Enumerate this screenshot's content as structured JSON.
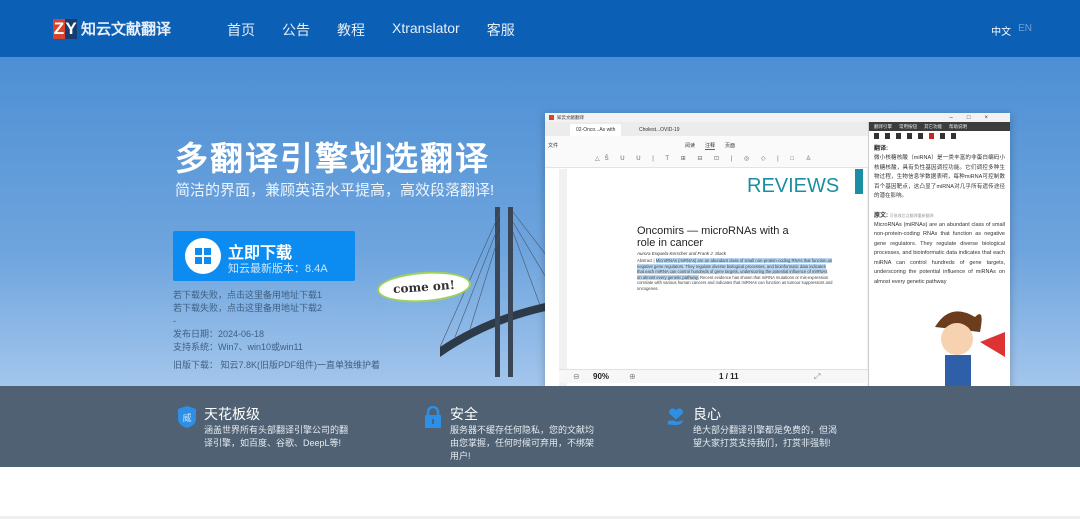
{
  "header": {
    "logo_mark": [
      "Z",
      "Y"
    ],
    "logo_text": "知云文献翻译",
    "nav": [
      "首页",
      "公告",
      "教程",
      "Xtranslator",
      "客服"
    ],
    "active_nav": "首页",
    "lang": {
      "zh": "中文",
      "en": "EN"
    }
  },
  "hero": {
    "title": "多翻译引擎划选翻译",
    "subtitle": "简洁的界面，兼顾英语水平提高，高效段落翻译!",
    "download": {
      "label": "立即下载",
      "version": "知云最新版本：8.4A"
    },
    "alt_links": [
      "若下载失败，点击这里备用地址下载1",
      "若下载失败，点击这里备用地址下载2"
    ],
    "dash": "-",
    "release_date": "发布日期：2024-06-18",
    "systems": "支持系统：Win7、win10或win11",
    "old_version": "旧版下载： 知云7.8K(旧版PDF组件)一直单独维护着"
  },
  "app_preview": {
    "window_title": "知云文献翻译",
    "tabs": [
      "02-Onco...As with",
      "Cholest...OVID-19"
    ],
    "menu": "文件",
    "modes": [
      "阅读",
      "注释",
      "页面"
    ],
    "reviews": "REVIEWS",
    "article_title": "Oncomirs — microRNAs with a role in cancer",
    "authors": "Aurora Esquela-Kerscher and Frank J. Slack",
    "abstract_prefix": "Abstract |",
    "abstract_highlight": "MicroRNAs (miRNAs) are an abundant class of small non-protein-coding RNAs that function as negative gene regulators. They regulate diverse biological processes, and bioinformatic data indicates that each miRNA can control hundreds of gene targets, underscoring the potential influence of miRNAs on almost every genetic pathway.",
    "abstract_rest": "Recent evidence has shown that miRNA mutations or mis-expression correlate with various human cancers and indicates that miRNAs can function as tumour suppressors and oncogenes.",
    "zoom": "90%",
    "page": "1 / 11",
    "panel_menu": [
      "翻译引擎",
      "常用按钮",
      "其它功能",
      "帮助说明"
    ],
    "translation_heading": "翻译:",
    "translation": "微小核糖核酸（miRNA）是一类丰富的非蛋白编码小核糖核酸，具有负性基因调控功能。它们调控多种生物过程，生物信息学数据表明，每种miRNA可控制数百个基因靶点，这凸显了miRNA对几乎所有遗传途径的潜在影响。",
    "source_heading": "原文:",
    "source_hint": "可修改后点翻译重新翻译",
    "source": "MicroRNAs (miRNAs) are an abundant class of small non-protein-coding RNAs that function as negative gene regulators. They regulate diverse biological processes, and bioinformatic data indicates that each miRNA can control hundreds of gene targets, underscoring the potential influence of miRNAs on almost every genetic pathway",
    "sticker": "come on!"
  },
  "features": [
    {
      "icon": "shield-icon",
      "badge": "威",
      "title": "天花板级",
      "desc": "涵盖世界所有头部翻译引擎公司的翻译引擎，如百度、谷歌、DeepL等!"
    },
    {
      "icon": "lock-icon",
      "title": "安全",
      "desc": "服务器不缓存任何隐私，您的文献均由您掌握，任何时候可弃用，不绑架用户!"
    },
    {
      "icon": "heart-hand-icon",
      "title": "良心",
      "desc": "绝大部分翻译引擎都是免费的，但渴望大家打赏支持我们，打赏非强制!"
    }
  ],
  "colors": {
    "header": "#0b5fb5",
    "download": "#0c8cf0",
    "band": "#4f6173",
    "reviews": "#1b8ea3"
  }
}
